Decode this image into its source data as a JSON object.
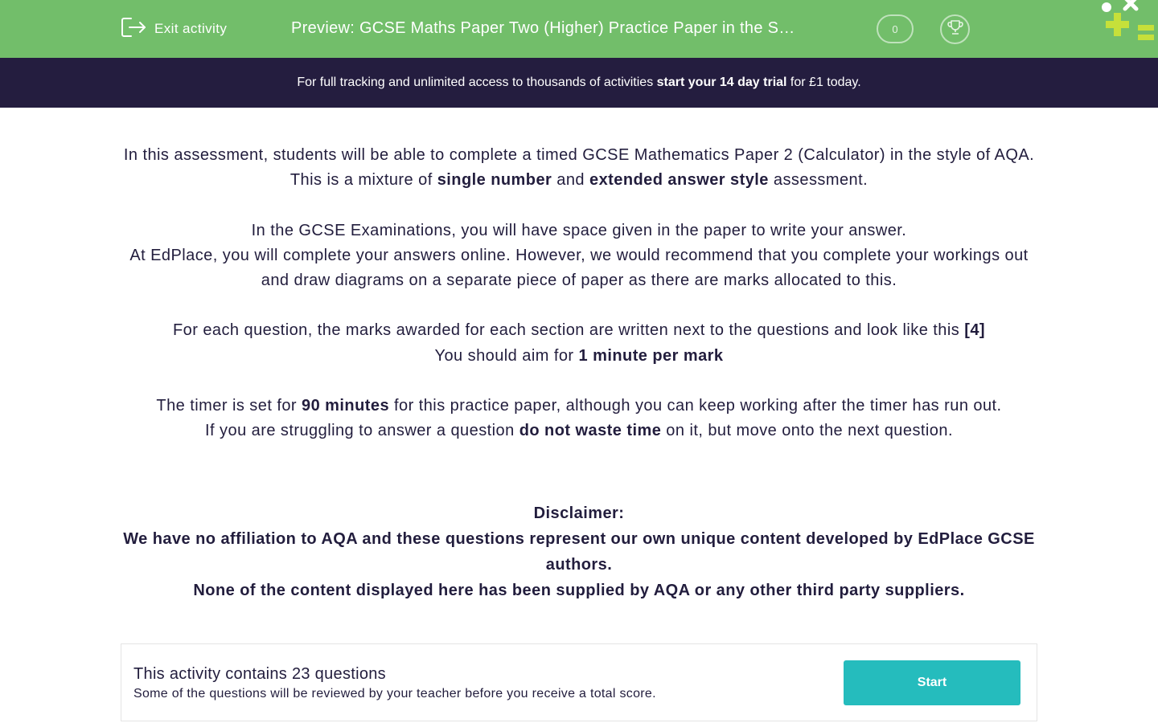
{
  "header": {
    "exit_label": "Exit activity",
    "title": "Preview: GCSE Maths Paper Two (Higher) Practice Paper in the Style of AQA",
    "score": "0"
  },
  "banner": {
    "text_before": "For full tracking and unlimited access to thousands of activities ",
    "cta": "start your 14 day trial",
    "text_after": " for £1 today."
  },
  "intro": {
    "p1": "In this assessment, students will be able to complete a timed GCSE Mathematics Paper 2 (Calculator) in the style of AQA.",
    "p2_before": "This is a mixture of ",
    "p2_b1": "single number",
    "p2_mid": " and ",
    "p2_b2": "extended answer style",
    "p2_after": " assessment.",
    "p3": "In the GCSE Examinations, you will have space given in the paper to write your answer.",
    "p4": "At EdPlace, you will complete your answers online.  However, we would recommend that you complete your workings out and draw diagrams on a separate piece of paper as there are marks allocated to this.",
    "p5_before": "For each question, the marks awarded for each section are written next to the questions and look like this ",
    "p5_b": "[4]",
    "p6_before": "You should aim for ",
    "p6_b": "1 minute per mark",
    "p7_before": "The timer is set for ",
    "p7_b": "90 minutes",
    "p7_after": " for this practice paper, although you can keep working after the timer has run out.",
    "p8_before": "If you are struggling to answer a question ",
    "p8_b": "do not waste time",
    "p8_after": " on it, but move onto the next question."
  },
  "disclaimer": {
    "title": "Disclaimer:",
    "line1": "We have no affiliation to AQA and these questions represent our own unique content developed by EdPlace GCSE authors.",
    "line2": "None of the content displayed here has been supplied by AQA or any other third party suppliers."
  },
  "footer": {
    "count": "This activity contains 23 questions",
    "note": "Some of the questions will be reviewed by your teacher before you receive a total score.",
    "start_label": "Start"
  },
  "colors": {
    "header_green": "#72be6a",
    "banner_navy": "#241d3f",
    "text": "#221d3d",
    "start_teal": "#25bcbd",
    "logo_lime": "#c6e03a"
  },
  "icons": {
    "exit": "exit-icon",
    "trophy": "trophy-icon",
    "logo": "edplace-logo"
  }
}
